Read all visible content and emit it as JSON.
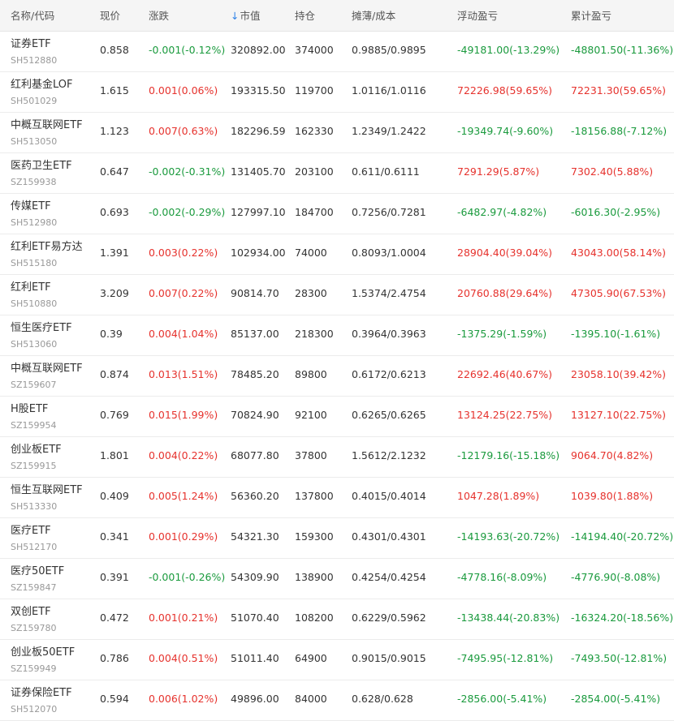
{
  "columns": {
    "name": "名称/代码",
    "price": "现价",
    "change": "涨跌",
    "sort_arrow": "↓",
    "market_value": "市值",
    "position": "持仓",
    "cost": "摊薄/成本",
    "float_pnl": "浮动盈亏",
    "total_pnl": "累计盈亏"
  },
  "colors": {
    "up": "#e6322d",
    "down": "#1a9a3d"
  },
  "rows": [
    {
      "name": "证券ETF",
      "code": "SH512880",
      "price": "0.858",
      "change": "-0.001(-0.12%)",
      "change_dir": "down",
      "market_value": "320892.00",
      "position": "374000",
      "cost": "0.9885/0.9895",
      "float_pnl": "-49181.00(-13.29%)",
      "float_dir": "down",
      "total_pnl": "-48801.50(-11.36%)",
      "total_dir": "down"
    },
    {
      "name": "红利基金LOF",
      "code": "SH501029",
      "price": "1.615",
      "change": "0.001(0.06%)",
      "change_dir": "up",
      "market_value": "193315.50",
      "position": "119700",
      "cost": "1.0116/1.0116",
      "float_pnl": "72226.98(59.65%)",
      "float_dir": "up",
      "total_pnl": "72231.30(59.65%)",
      "total_dir": "up"
    },
    {
      "name": "中概互联网ETF",
      "code": "SH513050",
      "price": "1.123",
      "change": "0.007(0.63%)",
      "change_dir": "up",
      "market_value": "182296.59",
      "position": "162330",
      "cost": "1.2349/1.2422",
      "float_pnl": "-19349.74(-9.60%)",
      "float_dir": "down",
      "total_pnl": "-18156.88(-7.12%)",
      "total_dir": "down"
    },
    {
      "name": "医药卫生ETF",
      "code": "SZ159938",
      "price": "0.647",
      "change": "-0.002(-0.31%)",
      "change_dir": "down",
      "market_value": "131405.70",
      "position": "203100",
      "cost": "0.611/0.6111",
      "float_pnl": "7291.29(5.87%)",
      "float_dir": "up",
      "total_pnl": "7302.40(5.88%)",
      "total_dir": "up"
    },
    {
      "name": "传媒ETF",
      "code": "SH512980",
      "price": "0.693",
      "change": "-0.002(-0.29%)",
      "change_dir": "down",
      "market_value": "127997.10",
      "position": "184700",
      "cost": "0.7256/0.7281",
      "float_pnl": "-6482.97(-4.82%)",
      "float_dir": "down",
      "total_pnl": "-6016.30(-2.95%)",
      "total_dir": "down"
    },
    {
      "name": "红利ETF易方达",
      "code": "SH515180",
      "price": "1.391",
      "change": "0.003(0.22%)",
      "change_dir": "up",
      "market_value": "102934.00",
      "position": "74000",
      "cost": "0.8093/1.0004",
      "float_pnl": "28904.40(39.04%)",
      "float_dir": "up",
      "total_pnl": "43043.00(58.14%)",
      "total_dir": "up"
    },
    {
      "name": "红利ETF",
      "code": "SH510880",
      "price": "3.209",
      "change": "0.007(0.22%)",
      "change_dir": "up",
      "market_value": "90814.70",
      "position": "28300",
      "cost": "1.5374/2.4754",
      "float_pnl": "20760.88(29.64%)",
      "float_dir": "up",
      "total_pnl": "47305.90(67.53%)",
      "total_dir": "up"
    },
    {
      "name": "恒生医疗ETF",
      "code": "SH513060",
      "price": "0.39",
      "change": "0.004(1.04%)",
      "change_dir": "up",
      "market_value": "85137.00",
      "position": "218300",
      "cost": "0.3964/0.3963",
      "float_pnl": "-1375.29(-1.59%)",
      "float_dir": "down",
      "total_pnl": "-1395.10(-1.61%)",
      "total_dir": "down"
    },
    {
      "name": "中概互联网ETF",
      "code": "SZ159607",
      "price": "0.874",
      "change": "0.013(1.51%)",
      "change_dir": "up",
      "market_value": "78485.20",
      "position": "89800",
      "cost": "0.6172/0.6213",
      "float_pnl": "22692.46(40.67%)",
      "float_dir": "up",
      "total_pnl": "23058.10(39.42%)",
      "total_dir": "up"
    },
    {
      "name": "H股ETF",
      "code": "SZ159954",
      "price": "0.769",
      "change": "0.015(1.99%)",
      "change_dir": "up",
      "market_value": "70824.90",
      "position": "92100",
      "cost": "0.6265/0.6265",
      "float_pnl": "13124.25(22.75%)",
      "float_dir": "up",
      "total_pnl": "13127.10(22.75%)",
      "total_dir": "up"
    },
    {
      "name": "创业板ETF",
      "code": "SZ159915",
      "price": "1.801",
      "change": "0.004(0.22%)",
      "change_dir": "up",
      "market_value": "68077.80",
      "position": "37800",
      "cost": "1.5612/2.1232",
      "float_pnl": "-12179.16(-15.18%)",
      "float_dir": "down",
      "total_pnl": "9064.70(4.82%)",
      "total_dir": "up"
    },
    {
      "name": "恒生互联网ETF",
      "code": "SH513330",
      "price": "0.409",
      "change": "0.005(1.24%)",
      "change_dir": "up",
      "market_value": "56360.20",
      "position": "137800",
      "cost": "0.4015/0.4014",
      "float_pnl": "1047.28(1.89%)",
      "float_dir": "up",
      "total_pnl": "1039.80(1.88%)",
      "total_dir": "up"
    },
    {
      "name": "医疗ETF",
      "code": "SH512170",
      "price": "0.341",
      "change": "0.001(0.29%)",
      "change_dir": "up",
      "market_value": "54321.30",
      "position": "159300",
      "cost": "0.4301/0.4301",
      "float_pnl": "-14193.63(-20.72%)",
      "float_dir": "down",
      "total_pnl": "-14194.40(-20.72%)",
      "total_dir": "down"
    },
    {
      "name": "医疗50ETF",
      "code": "SZ159847",
      "price": "0.391",
      "change": "-0.001(-0.26%)",
      "change_dir": "down",
      "market_value": "54309.90",
      "position": "138900",
      "cost": "0.4254/0.4254",
      "float_pnl": "-4778.16(-8.09%)",
      "float_dir": "down",
      "total_pnl": "-4776.90(-8.08%)",
      "total_dir": "down"
    },
    {
      "name": "双创ETF",
      "code": "SZ159780",
      "price": "0.472",
      "change": "0.001(0.21%)",
      "change_dir": "up",
      "market_value": "51070.40",
      "position": "108200",
      "cost": "0.6229/0.5962",
      "float_pnl": "-13438.44(-20.83%)",
      "float_dir": "down",
      "total_pnl": "-16324.20(-18.56%)",
      "total_dir": "down"
    },
    {
      "name": "创业板50ETF",
      "code": "SZ159949",
      "price": "0.786",
      "change": "0.004(0.51%)",
      "change_dir": "up",
      "market_value": "51011.40",
      "position": "64900",
      "cost": "0.9015/0.9015",
      "float_pnl": "-7495.95(-12.81%)",
      "float_dir": "down",
      "total_pnl": "-7493.50(-12.81%)",
      "total_dir": "down"
    },
    {
      "name": "证券保险ETF",
      "code": "SH512070",
      "price": "0.594",
      "change": "0.006(1.02%)",
      "change_dir": "up",
      "market_value": "49896.00",
      "position": "84000",
      "cost": "0.628/0.628",
      "float_pnl": "-2856.00(-5.41%)",
      "float_dir": "down",
      "total_pnl": "-2854.00(-5.41%)",
      "total_dir": "down"
    }
  ]
}
